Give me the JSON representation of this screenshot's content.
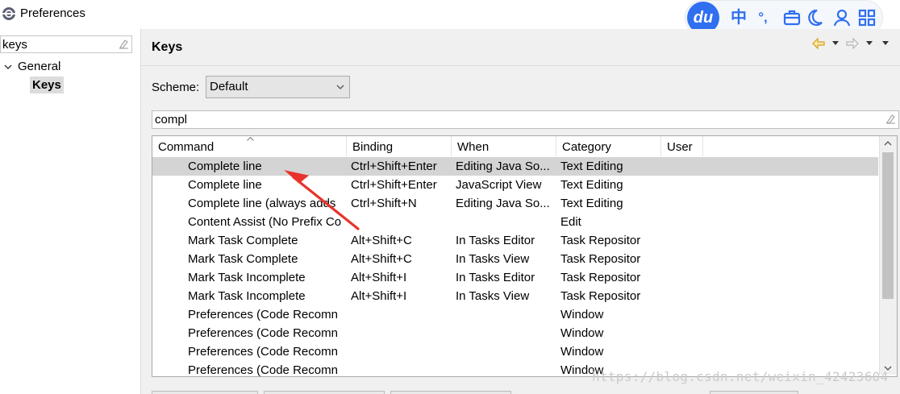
{
  "window": {
    "title": "Preferences"
  },
  "ime": {
    "logo": "du",
    "items": [
      "中",
      "°,"
    ]
  },
  "left_panel": {
    "filter_value": "keys",
    "tree": {
      "parent": "General",
      "child": "Keys"
    }
  },
  "page": {
    "title": "Keys",
    "scheme_label": "Scheme:",
    "scheme_value": "Default",
    "command_filter_value": "compl"
  },
  "table": {
    "columns": [
      "Command",
      "Binding",
      "When",
      "Category",
      "User"
    ],
    "rows": [
      {
        "command": "Complete line",
        "binding": "Ctrl+Shift+Enter",
        "when": "Editing Java So...",
        "category": "Text Editing",
        "user": ""
      },
      {
        "command": "Complete line",
        "binding": "Ctrl+Shift+Enter",
        "when": "JavaScript View",
        "category": "Text Editing",
        "user": ""
      },
      {
        "command": "Complete line (always adds",
        "binding": "Ctrl+Shift+N",
        "when": "Editing Java So...",
        "category": "Text Editing",
        "user": ""
      },
      {
        "command": "Content Assist (No Prefix Co",
        "binding": "",
        "when": "",
        "category": "Edit",
        "user": ""
      },
      {
        "command": "Mark Task Complete",
        "binding": "Alt+Shift+C",
        "when": "In Tasks Editor",
        "category": "Task Repositor",
        "user": ""
      },
      {
        "command": "Mark Task Complete",
        "binding": "Alt+Shift+C",
        "when": "In Tasks View",
        "category": "Task Repositor",
        "user": ""
      },
      {
        "command": "Mark Task Incomplete",
        "binding": "Alt+Shift+I",
        "when": "In Tasks Editor",
        "category": "Task Repositor",
        "user": ""
      },
      {
        "command": "Mark Task Incomplete",
        "binding": "Alt+Shift+I",
        "when": "In Tasks View",
        "category": "Task Repositor",
        "user": ""
      },
      {
        "command": "Preferences (Code Recomn",
        "binding": "",
        "when": "",
        "category": "Window",
        "user": ""
      },
      {
        "command": "Preferences (Code Recomn",
        "binding": "",
        "when": "",
        "category": "Window",
        "user": ""
      },
      {
        "command": "Preferences (Code Recomn",
        "binding": "",
        "when": "",
        "category": "Window",
        "user": ""
      },
      {
        "command": "Preferences (Code Recomn",
        "binding": "",
        "when": "",
        "category": "Window",
        "user": ""
      }
    ]
  },
  "watermark": "https://blog.csdn.net/weixin_42423604",
  "colors": {
    "ime_accent": "#2f6ff0",
    "selection": "#d4d4d4",
    "annotation_arrow": "#e8332a",
    "nav_back": "#d8a020"
  }
}
